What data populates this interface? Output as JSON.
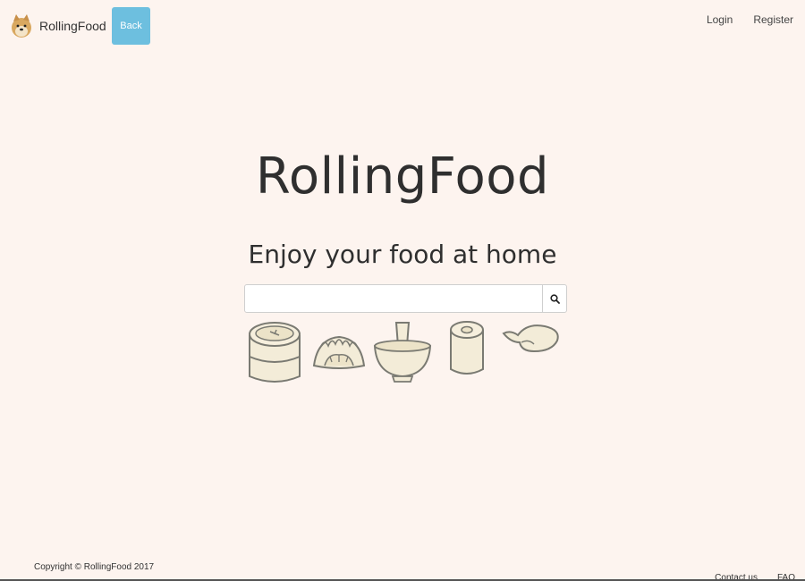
{
  "navbar": {
    "brand_name": "RollingFood",
    "back_label": "Back",
    "login_label": "Login",
    "register_label": "Register",
    "logo_icon": "doge-dog-icon",
    "back_color": "#6dbfdf"
  },
  "hero": {
    "title": "RollingFood",
    "subtitle": "Enjoy your food at home"
  },
  "search": {
    "value": "",
    "placeholder": "",
    "button_icon": "search-icon"
  },
  "food_icons": [
    "steamer-basket-icon",
    "dumplings-icon",
    "mortar-bowl-icon",
    "rice-roll-icon",
    "shrimp-dumpling-icon"
  ],
  "footer": {
    "copyright": "Copyright © RollingFood 2017",
    "contact_label": "Contact us",
    "faq_label": "FAQ"
  },
  "colors": {
    "background": "#fdf4ef",
    "food_fill": "#f3ecd8",
    "food_stroke": "#7a7a72"
  }
}
